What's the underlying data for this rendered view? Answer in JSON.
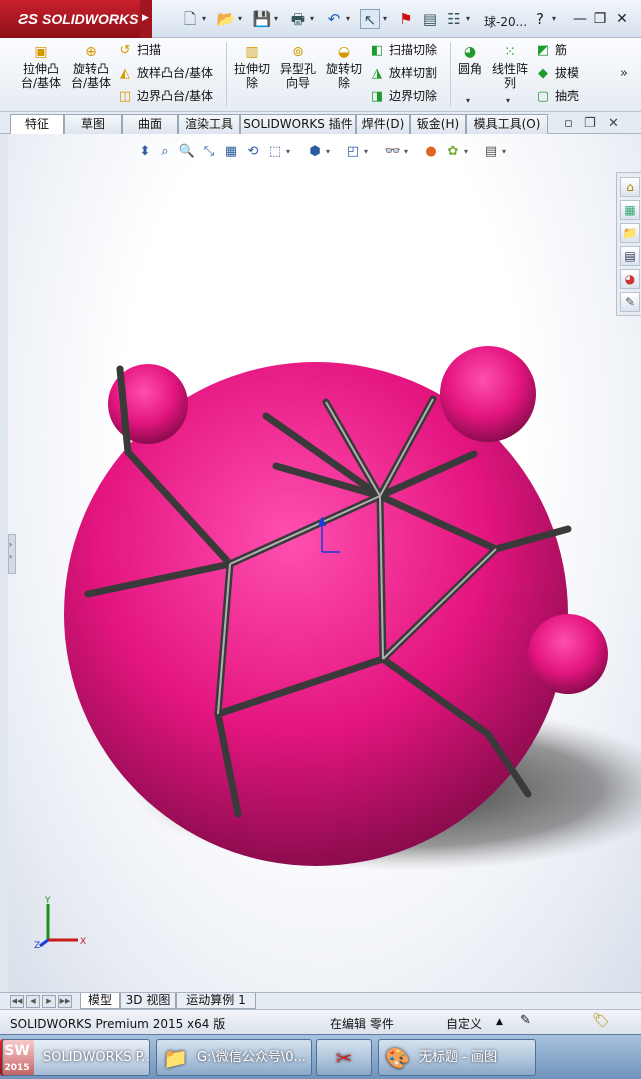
{
  "app": {
    "brand": "SOLIDWORKS",
    "doc_title": "球-20..."
  },
  "icons": {
    "new": "new-document-icon",
    "open": "open-folder-icon",
    "save": "save-icon",
    "print": "print-icon",
    "undo": "undo-icon",
    "select": "select-arrow-icon",
    "rebuild": "traffic-light-icon",
    "file_props": "file-properties-icon",
    "options": "options-icon",
    "help": "help-icon"
  },
  "ribbon": {
    "extrude_boss": "拉伸凸\n台/基体",
    "revolve_boss": "旋转凸\n台/基体",
    "sweep": "扫描",
    "loft": "放样凸台/基体",
    "boundary_boss": "边界凸台/基体",
    "extrude_cut": "拉伸切\n除",
    "hole_wizard": "异型孔\n向导",
    "revolve_cut": "旋转切\n除",
    "sweep_cut": "扫描切除",
    "loft_cut": "放样切割",
    "boundary_cut": "边界切除",
    "fillet": "圆角",
    "linear_pattern": "线性阵\n列",
    "rib": "筋",
    "draft": "拔模",
    "shell": "抽壳"
  },
  "tabs": [
    "特征",
    "草图",
    "曲面",
    "渲染工具",
    "SOLIDWORKS 插件",
    "焊件(D)",
    "钣金(H)",
    "模具工具(O)"
  ],
  "bottom_tabs": [
    "模型",
    "3D 视图",
    "运动算例 1"
  ],
  "status": {
    "product": "SOLIDWORKS Premium 2015 x64 版",
    "mode": "在编辑 零件",
    "units": "自定义"
  },
  "taskbar": {
    "badge_top": "SW",
    "badge_bottom": "2015",
    "items": [
      "SOLIDWORKS P...",
      "G:\\微信公众号\\0...",
      "",
      "无标题 - 画图"
    ]
  },
  "colors": {
    "model": "#e4157f",
    "accent": "#c8202c"
  }
}
